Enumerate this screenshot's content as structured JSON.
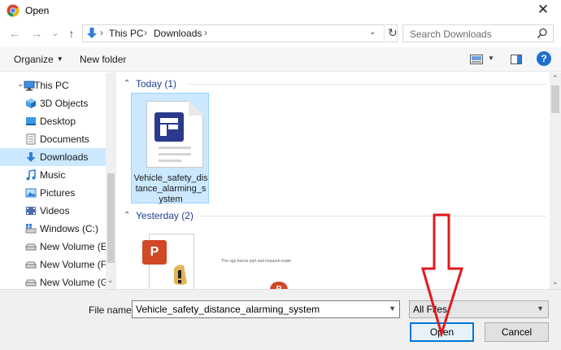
{
  "window": {
    "title": "Open",
    "close_glyph": "✕"
  },
  "nav": {
    "back_glyph": "←",
    "forward_glyph": "→",
    "recent_glyph": "⌄",
    "up_glyph": "↑",
    "breadcrumbs": [
      "This PC",
      "Downloads"
    ],
    "separator": "›",
    "search_placeholder": "Search Downloads"
  },
  "toolbar": {
    "organize_label": "Organize",
    "new_folder_label": "New folder",
    "help_glyph": "?"
  },
  "sidebar": {
    "items": [
      {
        "label": "This PC",
        "icon": "computer-icon"
      },
      {
        "label": "3D Objects",
        "icon": "cube-icon"
      },
      {
        "label": "Desktop",
        "icon": "desktop-icon"
      },
      {
        "label": "Documents",
        "icon": "documents-icon"
      },
      {
        "label": "Downloads",
        "icon": "download-icon",
        "selected": true
      },
      {
        "label": "Music",
        "icon": "music-icon"
      },
      {
        "label": "Pictures",
        "icon": "pictures-icon"
      },
      {
        "label": "Videos",
        "icon": "videos-icon"
      },
      {
        "label": "Windows (C:)",
        "icon": "drive-icon"
      },
      {
        "label": "New Volume (E:)",
        "icon": "drive-icon"
      },
      {
        "label": "New Volume (F:)",
        "icon": "drive-icon"
      },
      {
        "label": "New Volume (G:)",
        "icon": "drive-icon"
      }
    ]
  },
  "main": {
    "groups": [
      {
        "label": "Today (1)"
      },
      {
        "label": "Yesterday (2)"
      }
    ],
    "today_file_name": "Vehicle_safety_distance_alarming_system",
    "tiny_preview_text": "The ogp bonus part sad neaandi reade"
  },
  "bottom": {
    "file_name_label": "File name:",
    "file_name_value": "Vehicle_safety_distance_alarming_system",
    "filter_value": "All Files",
    "open_label": "Open",
    "cancel_label": "Cancel"
  },
  "colors": {
    "selection": "#cce8ff",
    "accent": "#0078d7",
    "group_header": "#1e3f8f",
    "annotation_arrow": "#e0191e"
  }
}
